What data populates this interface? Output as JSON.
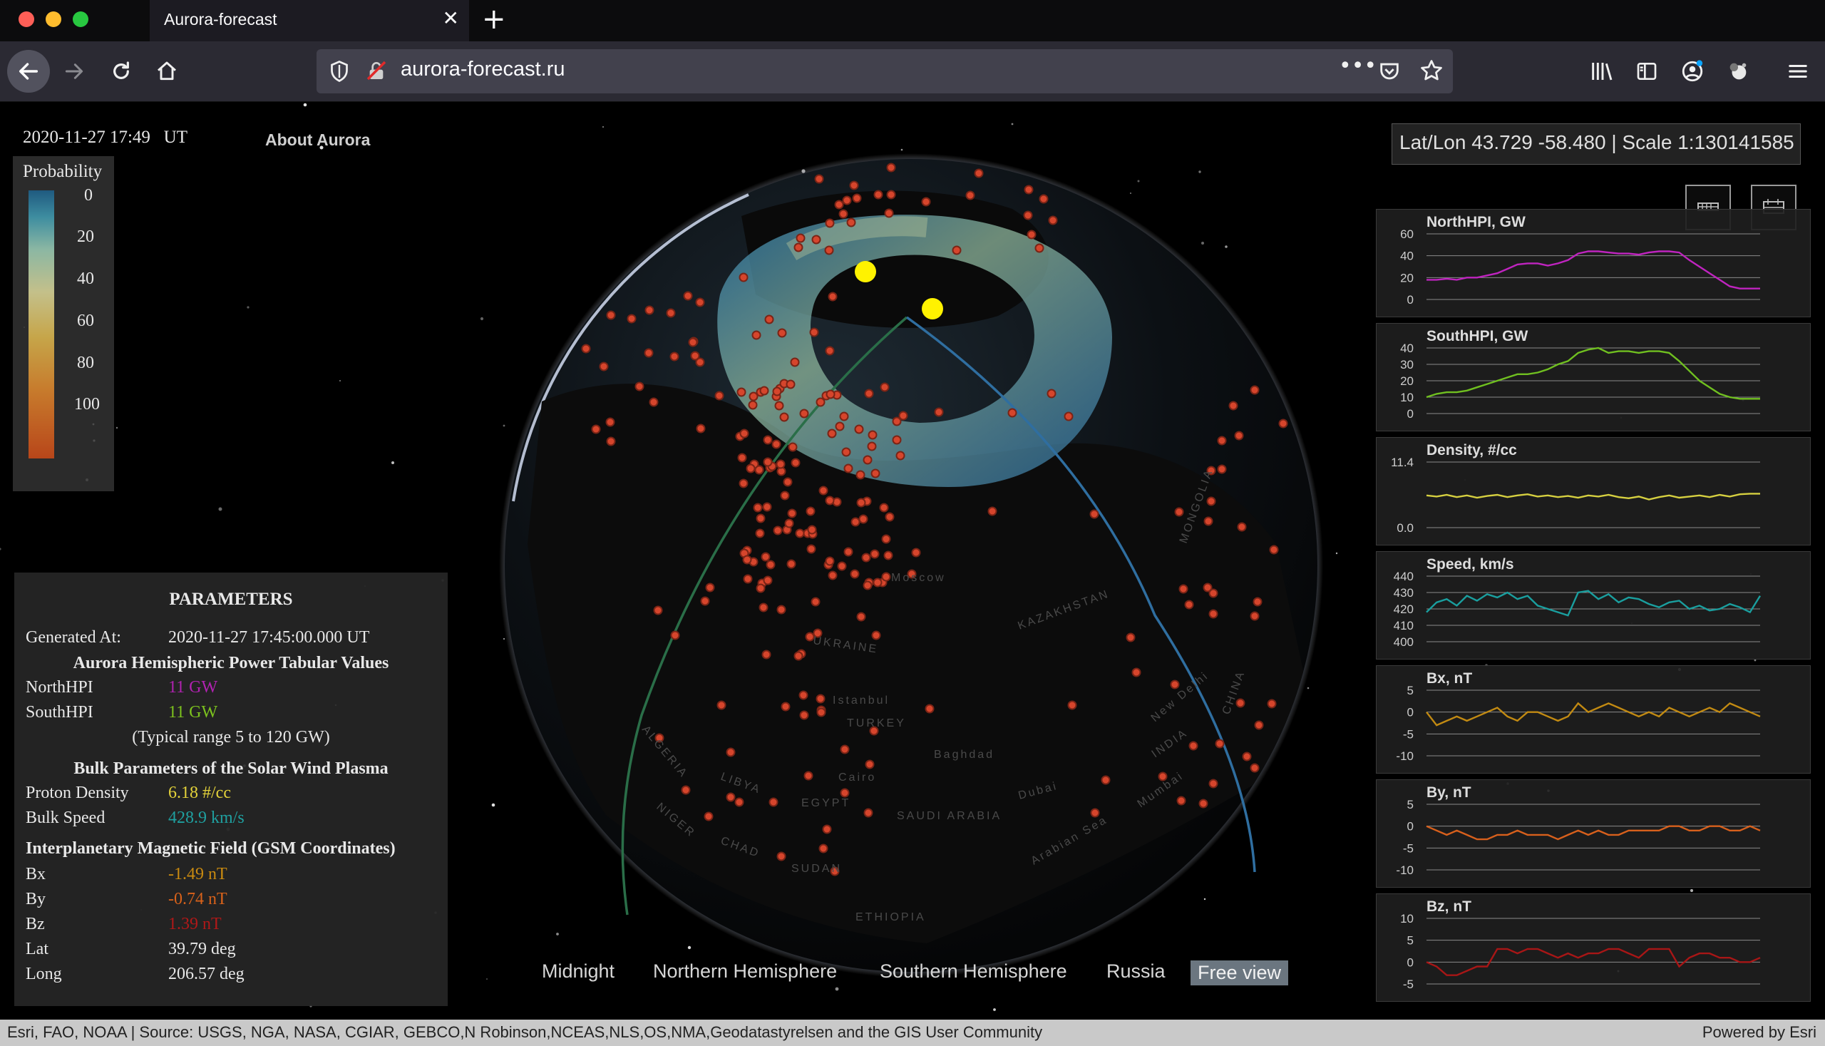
{
  "browser": {
    "tab_title": "Aurora-forecast",
    "url": "aurora-forecast.ru"
  },
  "page": {
    "timestamp": "2020-11-27 17:49   UT",
    "about_link": "About Aurora",
    "coords": "Lat/Lon 43.729 -58.480 | Scale 1:130141585"
  },
  "legend": {
    "title": "Probability",
    "ticks": [
      "0",
      "20",
      "40",
      "60",
      "80",
      "100"
    ],
    "colors": [
      "#1f5a80",
      "#8bb7a3",
      "#c6a549",
      "#b8461a"
    ]
  },
  "params": {
    "title": "PARAMETERS",
    "generated_label": "Generated At:",
    "generated_value": "2020-11-27 17:45:00.000 UT",
    "hpi_header": "Aurora Hemispheric Power Tabular Values",
    "north_label": "NorthHPI",
    "north_value": "11 GW",
    "south_label": "SouthHPI",
    "south_value": "11 GW",
    "typical_range": "(Typical range 5 to 120 GW)",
    "bulk_header": "Bulk Parameters of the Solar Wind Plasma",
    "density_label": "Proton Density",
    "density_value": "6.18 #/cc",
    "speed_label": "Bulk Speed",
    "speed_value": "428.9 km/s",
    "imf_header": "Interplanetary Magnetic Field (GSM Coordinates)",
    "bx_label": "Bx",
    "bx_value": "-1.49 nT",
    "by_label": "By",
    "by_value": "-0.74 nT",
    "bz_label": "Bz",
    "bz_value": "1.39 nT",
    "lat_label": "Lat",
    "lat_value": "39.79 deg",
    "long_label": "Long",
    "long_value": "206.57 deg",
    "colors": {
      "north": "#b022b0",
      "south": "#7cc21e",
      "density": "#e3d23a",
      "speed": "#1fa0a0",
      "bx": "#c98a10",
      "by": "#d9621a",
      "bz": "#b01818"
    }
  },
  "views": [
    "Midnight",
    "Northern Hemisphere",
    "Southern Hemisphere",
    "Russia",
    "Free view"
  ],
  "attribution": {
    "text": "Esri, FAO, NOAA | Source: USGS, NGA, NASA, CGIAR, GEBCO,N Robinson,NCEAS,NLS,OS,NMA,Geodatastyrelsen and the GIS User Community",
    "powered": "Powered by Esri"
  },
  "globe_labels": [
    "Moscow",
    "UKRAINE",
    "KAZAKHSTAN",
    "TURKEY",
    "Istanbul",
    "Baghdad",
    "LIBYA",
    "EGYPT",
    "SAUDI ARABIA",
    "SUDAN",
    "CHAD",
    "NIGER",
    "ALGERIA",
    "ETHIOPIA",
    "Cairo",
    "Dubai",
    "INDIA",
    "Mumbai",
    "New Delhi",
    "CHINA",
    "MONGOLIA",
    "Arabian Sea"
  ],
  "chart_data": [
    {
      "type": "line",
      "title": "NorthHPI, GW",
      "yticks": [
        "60",
        "40",
        "20",
        "0"
      ],
      "ylim": [
        0,
        60
      ],
      "values": [
        18,
        18,
        19,
        18,
        20,
        20,
        22,
        24,
        28,
        32,
        33,
        33,
        31,
        33,
        36,
        42,
        44,
        44,
        43,
        42,
        42,
        41,
        43,
        44,
        44,
        43,
        36,
        30,
        24,
        18,
        12,
        10,
        10,
        10
      ],
      "color": "#c024c0"
    },
    {
      "type": "line",
      "title": "SouthHPI, GW",
      "yticks": [
        "40",
        "30",
        "20",
        "10",
        "0"
      ],
      "ylim": [
        0,
        40
      ],
      "values": [
        10,
        12,
        13,
        13,
        14,
        16,
        18,
        20,
        22,
        24,
        24,
        25,
        27,
        30,
        32,
        37,
        39,
        40,
        37,
        38,
        38,
        37,
        38,
        38,
        37,
        32,
        26,
        20,
        16,
        12,
        10,
        9,
        9,
        9
      ],
      "color": "#70c020"
    },
    {
      "type": "line",
      "title": "Density, #/cc",
      "yticks": [
        "11.4",
        "0.0"
      ],
      "ylim": [
        0,
        11.4
      ],
      "values": [
        5.6,
        5.4,
        5.7,
        5.3,
        5.6,
        5.2,
        5.5,
        5.7,
        5.3,
        5.6,
        5.8,
        5.4,
        5.6,
        5.3,
        5.5,
        5.2,
        5.6,
        5.4,
        5.7,
        5.3,
        5.1,
        5.4,
        4.9,
        5.3,
        5.6,
        5.2,
        5.4,
        5.6,
        5.3,
        5.7,
        5.4,
        5.8,
        5.9,
        5.9
      ],
      "color": "#d6d040"
    },
    {
      "type": "line",
      "title": "Speed, km/s",
      "yticks": [
        "440",
        "430",
        "420",
        "410",
        "400"
      ],
      "ylim": [
        400,
        440
      ],
      "values": [
        418,
        424,
        426,
        422,
        428,
        425,
        429,
        427,
        430,
        426,
        428,
        422,
        420,
        418,
        416,
        430,
        431,
        426,
        429,
        424,
        427,
        426,
        423,
        421,
        424,
        425,
        420,
        422,
        419,
        420,
        423,
        421,
        418,
        428
      ],
      "color": "#1a9f9f"
    },
    {
      "type": "line",
      "title": "Bx, nT",
      "yticks": [
        "5",
        "0",
        "-5",
        "-10"
      ],
      "ylim": [
        -10,
        5
      ],
      "values": [
        0,
        -3,
        -2,
        -1,
        -2,
        -1,
        0,
        1,
        -1,
        -2,
        0,
        0,
        -1,
        -2,
        -1,
        2,
        0,
        1,
        2,
        1,
        0,
        -1,
        0,
        -1,
        1,
        0,
        -1,
        0,
        1,
        0,
        2,
        1,
        0,
        -1
      ],
      "color": "#c28a12"
    },
    {
      "type": "line",
      "title": "By, nT",
      "yticks": [
        "5",
        "0",
        "-5",
        "-10"
      ],
      "ylim": [
        -10,
        5
      ],
      "values": [
        0,
        -1,
        -2,
        -1,
        -2,
        -3,
        -3,
        -2,
        -2,
        -1,
        -2,
        -2,
        -2,
        -3,
        -2,
        -1,
        -2,
        -1,
        -2,
        -2,
        -1,
        -1,
        -1,
        -1,
        0,
        0,
        -1,
        -1,
        0,
        0,
        -1,
        -1,
        0,
        -1
      ],
      "color": "#d8601c"
    },
    {
      "type": "line",
      "title": "Bz, nT",
      "yticks": [
        "10",
        "5",
        "0",
        "-5"
      ],
      "ylim": [
        -5,
        10
      ],
      "values": [
        0,
        -1,
        -3,
        -3,
        -2,
        -1,
        -1,
        3,
        3,
        2,
        3,
        3,
        2,
        1,
        2,
        1,
        2,
        2,
        3,
        3,
        2,
        1,
        3,
        3,
        3,
        -1,
        1,
        2,
        2,
        1,
        1,
        0,
        0,
        1
      ],
      "color": "#a81616"
    }
  ]
}
